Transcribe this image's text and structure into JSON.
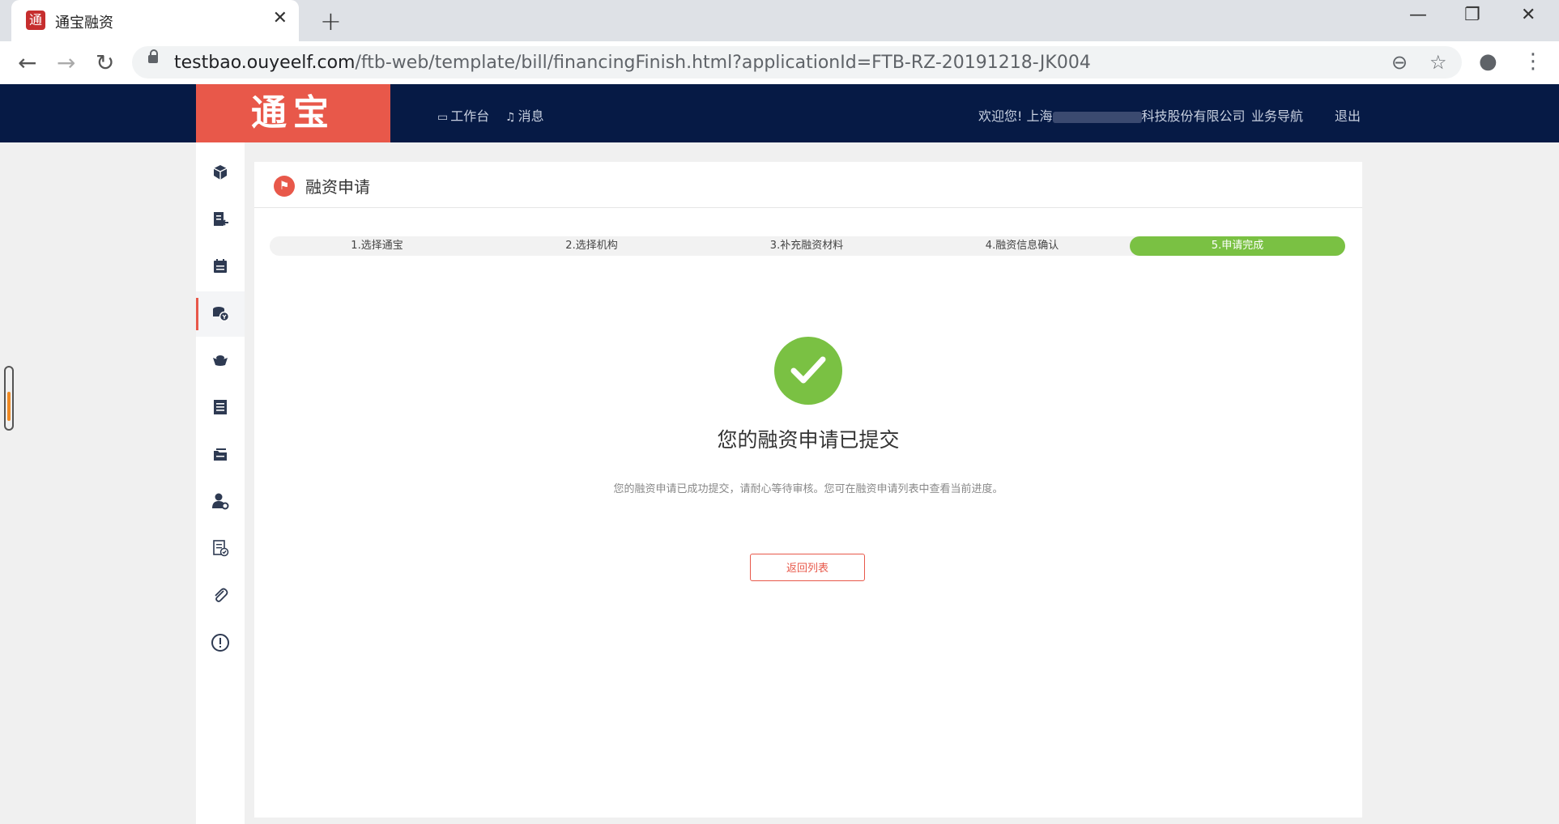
{
  "browser": {
    "tab_title": "通宝融资",
    "favicon_text": "通",
    "url_host": "testbao.ouyeelf.com",
    "url_path": "/ftb-web/template/bill/financingFinish.html?applicationId=FTB-RZ-20191218-JK004"
  },
  "header": {
    "logo_text": "通宝",
    "nav": [
      {
        "icon": "monitor-icon",
        "label": "工作台"
      },
      {
        "icon": "bell-icon",
        "label": "消息"
      }
    ],
    "welcome_prefix": "欢迎您!  上海",
    "welcome_suffix": "科技股份有限公司",
    "business_nav": "业务导航",
    "logout": "退出"
  },
  "sidebar": {
    "items": [
      {
        "icon": "cube-icon"
      },
      {
        "icon": "document-return-icon"
      },
      {
        "icon": "calendar-icon"
      },
      {
        "icon": "coins-icon",
        "active": true
      },
      {
        "icon": "ingot-icon"
      },
      {
        "icon": "list-icon"
      },
      {
        "icon": "folder-stack-icon"
      },
      {
        "icon": "user-settings-icon"
      },
      {
        "icon": "document-check-icon"
      },
      {
        "icon": "paperclip-icon"
      },
      {
        "icon": "alert-circle-icon"
      }
    ]
  },
  "panel": {
    "title": "融资申请",
    "steps": [
      {
        "label": "1.选择通宝",
        "done": false
      },
      {
        "label": "2.选择机构",
        "done": false
      },
      {
        "label": "3.补充融资材料",
        "done": false
      },
      {
        "label": "4.融资信息确认",
        "done": false
      },
      {
        "label": "5.申请完成",
        "done": true
      }
    ],
    "success_title": "您的融资申请已提交",
    "success_desc": "您的融资申请已成功提交，请耐心等待审核。您可在融资申请列表中查看当前进度。",
    "back_button": "返回列表"
  },
  "colors": {
    "header_bg": "#061a45",
    "brand_red": "#e8584a",
    "success_green": "#7ac143"
  }
}
